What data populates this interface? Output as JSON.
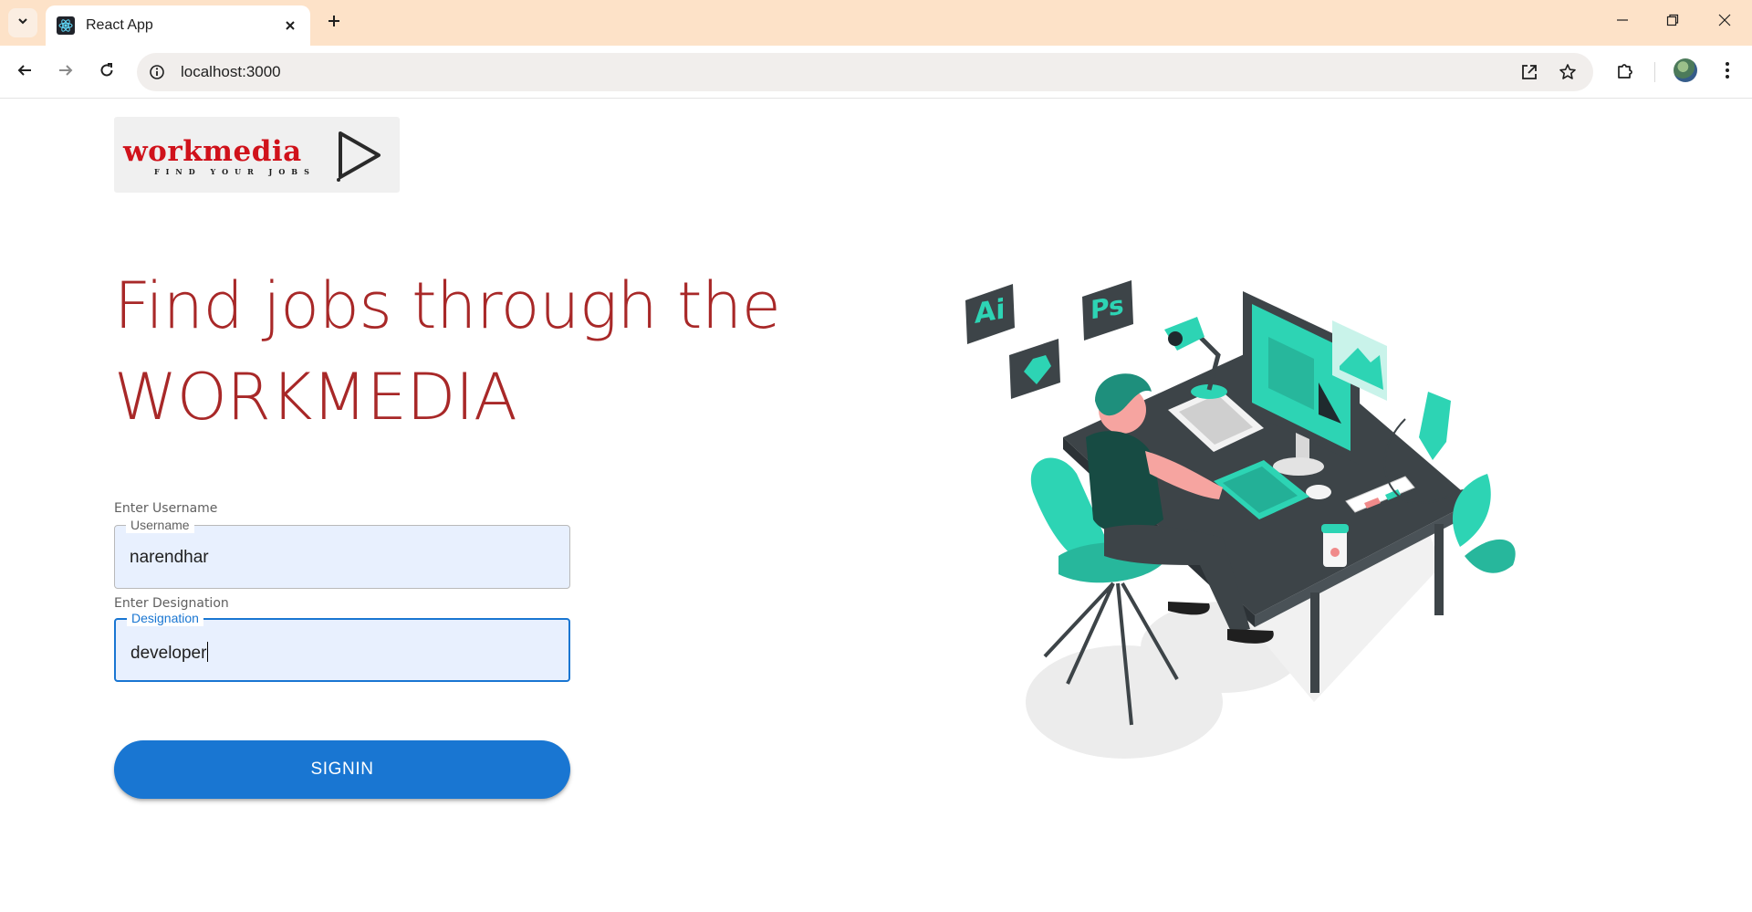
{
  "browser": {
    "tab_title": "React App",
    "url": "localhost:3000"
  },
  "logo": {
    "word": "workmedia",
    "tagline": "FIND YOUR JOBS"
  },
  "hero": {
    "line1": "Find jobs through the",
    "line2": "WORKMEDIA"
  },
  "form": {
    "username": {
      "caption": "Enter Username",
      "label": "Username",
      "value": "narendhar"
    },
    "designation": {
      "caption": "Enter Designation",
      "label": "Designation",
      "value": "developer"
    },
    "submit_label": "SIGNIN"
  },
  "illustration": {
    "ai_badge": "Ai",
    "ps_badge": "Ps"
  },
  "colors": {
    "accent": "#1976d2",
    "hero_text": "#a82828",
    "logo_red": "#d0121b",
    "tab_bar": "#fde2c8",
    "teal": "#2dd4b4"
  },
  "icons": {
    "tab_list": "chevron-down-icon",
    "favicon": "react-icon",
    "tab_close": "close-icon",
    "new_tab": "plus-icon",
    "minimize": "minimize-icon",
    "restore": "restore-icon",
    "close_window": "close-icon",
    "back": "arrow-left-icon",
    "forward": "arrow-right-icon",
    "reload": "reload-icon",
    "site_info": "info-icon",
    "open_in_app": "external-link-icon",
    "bookmark": "star-icon",
    "extensions": "puzzle-icon",
    "menu": "kebab-menu-icon"
  }
}
